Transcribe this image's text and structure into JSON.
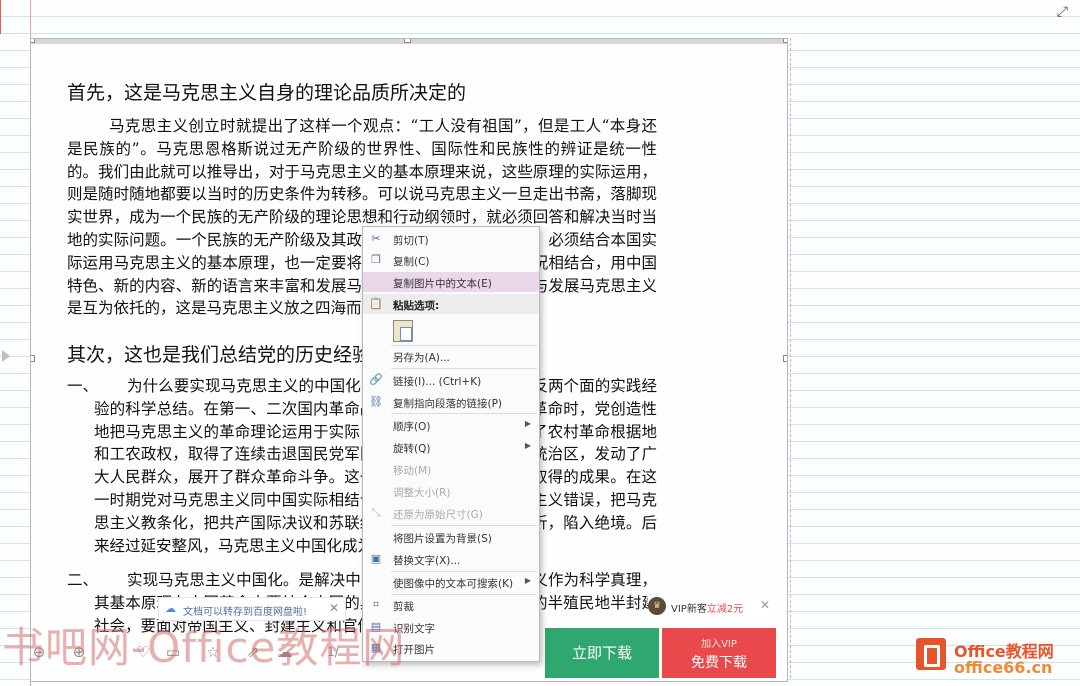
{
  "document": {
    "heading1": "首先，这是马克思主义自身的理论品质所决定的",
    "para1": "马克思主义创立时就提出了这样一个观点：“工人没有祖国”，但是工人“本身还是民族的”。马克思恩格斯说过无产阶级的世界性、国际性和民族性的辨证是统一性的。我们由此就可以推导出，对于马克思主义的基本原理来说，这些原理的实际运用，则是随时随地都要以当时的历史条件为转移。可以说马克思主义一旦走出书斋，落脚现实世界，成为一个民族的无产阶级的理论思想和行动纲领时，就必须回答和解决当时当地的实际问题。一个民族的无产阶级及其政治上的先锋队——共产党，必须结合本国实际运用马克思主义的基本原理，也一定要将这一原理和本国的实际情况相结合，用中国特色、新的内容、新的语言来丰富和发展马克思主义。所以，中国化与发展马克思主义是互为依托的，这是马克思主义放之四海而皆准的原因。",
    "heading2": "其次，这也是我们总结党的历史经验得出的重要结论。",
    "item1_num": "一、",
    "item1_text": "为什么要实现马克思主义的中国化，这是党在历史过程中正反两个面的实践经验的科学总结。在第一、二次国内革命战争时期，特别是第二次革命时，党创造性地把马克思主义的革命理论运用于实际，创建了工农红军，建立了农村革命根据地和工农政权，取得了连续击退国民党军队的多次围剿；在国民党统治区，发动了广大人民群众，展开了群众革命斗争。这一切都是从中国实际出发取得的成果。在这一时期党对马克思主义同中国实际相结合还不够自觉，犯过教条主义错误，把马克思主义教条化，把共产国际决议和苏联经验神圣化，使革命受挫折，陷入绝境。后来经过延安整风，马克思主义中国化成为全党的共识。",
    "item2_num": "二、",
    "item2_text": "实现马克思主义中国化。是解决中国问题的关键。马克思主义作为科学真理，其基本原理在中国革命中要结合中国的具体国情，在旧中国这样的半殖民地半封建社会，要面对帝国主义、封建主义和官僚资本主义国家。"
  },
  "context_menu": {
    "items": [
      {
        "label": "剪切(T)",
        "icon": "cut-icon"
      },
      {
        "label": "复制(C)",
        "icon": "copy-icon"
      },
      {
        "label": "复制图片中的文本(E)",
        "icon": ""
      },
      {
        "label": "粘贴选项:",
        "icon": "paste-icon"
      },
      {
        "label": "另存为(A)...",
        "icon": ""
      },
      {
        "label": "链接(I)...  (Ctrl+K)",
        "icon": "link-icon"
      },
      {
        "label": "复制指向段落的链接(P)",
        "icon": "link-paragraph-icon"
      },
      {
        "label": "顺序(O)",
        "icon": ""
      },
      {
        "label": "旋转(Q)",
        "icon": ""
      },
      {
        "label": "移动(M)",
        "icon": ""
      },
      {
        "label": "调整大小(R)",
        "icon": ""
      },
      {
        "label": "还原为原始尺寸(G)",
        "icon": "restore-size-icon"
      },
      {
        "label": "将图片设置为背景(S)",
        "icon": ""
      },
      {
        "label": "替换文字(X)...",
        "icon": "alt-text-icon"
      },
      {
        "label": "使图像中的文本可搜索(K)",
        "icon": ""
      },
      {
        "label": "剪裁",
        "icon": "crop-icon"
      },
      {
        "label": "识别文字",
        "icon": "ocr-icon"
      },
      {
        "label": "打开图片",
        "icon": "open-image-icon"
      }
    ]
  },
  "toolbar": {
    "notice_text": "文档可以转存到百度网盘啦!",
    "page_indicator": "1/",
    "download_button": "立即下载",
    "vip_small": "加入VIP",
    "vip_button": "免费下载",
    "vip_banner_prefix": "VIP新客",
    "vip_banner_highlight": "立减2元"
  },
  "watermark": {
    "text": "书吧网-Office教程网"
  },
  "logo": {
    "line1": "Office教程网",
    "line2": "office66.cn"
  },
  "colors": {
    "green_button": "#2fa870",
    "red_button": "#e9494a",
    "menu_highlight": "#ead7ea",
    "logo_orange": "#e8552a"
  }
}
